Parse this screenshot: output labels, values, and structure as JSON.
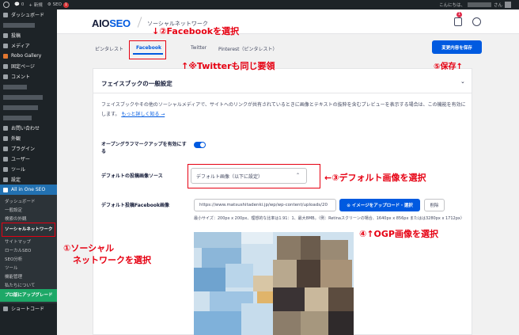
{
  "adminbar": {
    "comments_count": "0",
    "new_label": "+ 新規",
    "seo_label": "SEO",
    "seo_badge": "1",
    "greeting_prefix": "こんにちは、",
    "greeting_suffix": "さん"
  },
  "sidebar": {
    "dashboard": "ダッシュボード",
    "posts": "投稿",
    "media": "メディア",
    "robo_gallery": "Robo Gallery",
    "pages": "固定ページ",
    "comments": "コメント",
    "contact": "お問い合わせ",
    "appearance": "外観",
    "plugins": "プラグイン",
    "users": "ユーザー",
    "tools": "ツール",
    "settings": "設定",
    "aioseo": "All in One SEO",
    "submenu": {
      "dashboard": "ダッシュボード",
      "general": "一般設定",
      "search_appearance": "検索の外観",
      "social_networks": "ソーシャルネットワーク",
      "sitemap": "サイトマップ",
      "local_seo": "ローカルSEO",
      "seo_analysis": "SEO分析",
      "tools": "ツール",
      "feature_manager": "機能管理",
      "about": "私たちについて",
      "upgrade": "プロ版にアップグレード"
    },
    "shortcode": "ショートコード"
  },
  "header": {
    "logo_main": "AIO",
    "logo_seo": "SEO",
    "title": "ソーシャルネットワーク",
    "notif_count": "1"
  },
  "tabs": {
    "pinterest": "ピンタレスト",
    "facebook": "Facebook",
    "twitter": "Twitter",
    "pinterest_jp": "Pinterest（ピンタレスト）",
    "save": "変更内容を保存"
  },
  "card": {
    "title": "フェイスブックの一般設定",
    "description": "フェイスブックやその他のソーシャルメディアで、サイトへのリンクが共有されているときに画像とテキストの抜粋を含むプレビューを表示する場合は、この機能を有効にします。",
    "learn_more": "もっと詳しく知る →",
    "og_label": "オープングラフマークアップを有効にする",
    "src_label": "デフォルトの投稿画像ソース",
    "src_value": "デフォルト画像（以下に設定）",
    "img_label": "デフォルト投稿Facebook画像",
    "url_value": "https://www.matsushitadenki.jp/wp/wp-content/uploads/20",
    "upload_label": "⊙ イメージをアップロード・選択",
    "delete_label": "削除",
    "size_note": "最小サイズ：200px x 200px、理想的な比率は1.91：1、最大8MB。（例：Retinaスクリーンの場合、1640px x 856px またはは3280px x 1712px）"
  },
  "annotations": {
    "facebook": "↓②Facebookを選択",
    "twitter": "↑※Twitterも同じ要領",
    "save": "⑤保存↑",
    "default_image": "←③デフォルト画像を選択",
    "ogp": "④↑OGP画像を選択",
    "social_line1": "①ソーシャル",
    "social_line2": "ネットワークを選択"
  },
  "colors": {
    "accent": "#005ae0",
    "annotation": "#e60012",
    "sidebar_bg": "#1d2327",
    "sidebar_active": "#2271b1",
    "upgrade_green": "#1da867"
  }
}
